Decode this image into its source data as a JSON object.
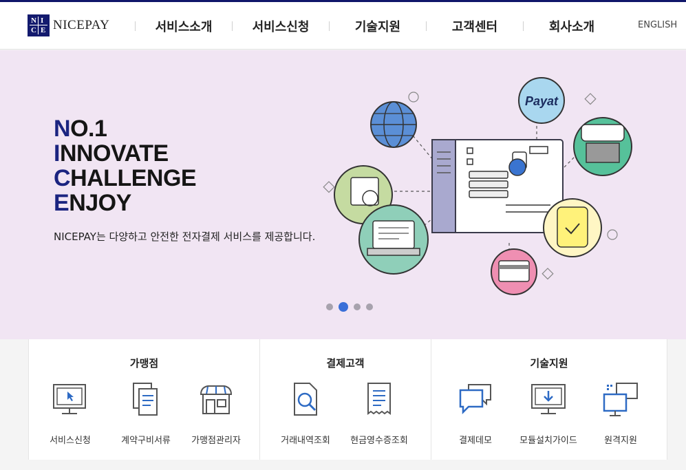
{
  "header": {
    "logo_letters": [
      "N",
      "I",
      "C",
      "E"
    ],
    "logo_text": "NICEPAY",
    "nav": [
      "서비스소개",
      "서비스신청",
      "기술지원",
      "고객센터",
      "회사소개"
    ],
    "language": "ENGLISH"
  },
  "banner": {
    "slogan": [
      {
        "first": "N",
        "rest": "O.1"
      },
      {
        "first": "I",
        "rest": "NNOVATE"
      },
      {
        "first": "C",
        "rest": "HALLENGE"
      },
      {
        "first": "E",
        "rest": "NJOY"
      }
    ],
    "description": "NICEPAY는 다양하고 안전한 전자결제 서비스를 제공합니다.",
    "badge_text": "Payat",
    "slide_count": 4,
    "active_slide": 2
  },
  "quick_menu": {
    "groups": [
      {
        "title": "가맹점",
        "items": [
          "서비스신청",
          "계약구비서류",
          "가맹점관리자"
        ]
      },
      {
        "title": "결제고객",
        "items": [
          "거래내역조회",
          "현금영수증조회"
        ]
      },
      {
        "title": "기술지원",
        "items": [
          "결제데모",
          "모듈설치가이드",
          "원격지원"
        ]
      }
    ]
  },
  "icons": [
    "monitor-cursor-icon",
    "documents-icon",
    "store-icon",
    "search-document-icon",
    "receipt-icon",
    "chat-icon",
    "download-monitor-icon",
    "remote-monitors-icon"
  ],
  "colors": {
    "brand": "#131a6e",
    "banner_bg": "#f1e5f3",
    "active_dot": "#3a6fd8",
    "icon_blue": "#2d6ac4",
    "highlight": "#fff200",
    "underline": "#e31313"
  }
}
